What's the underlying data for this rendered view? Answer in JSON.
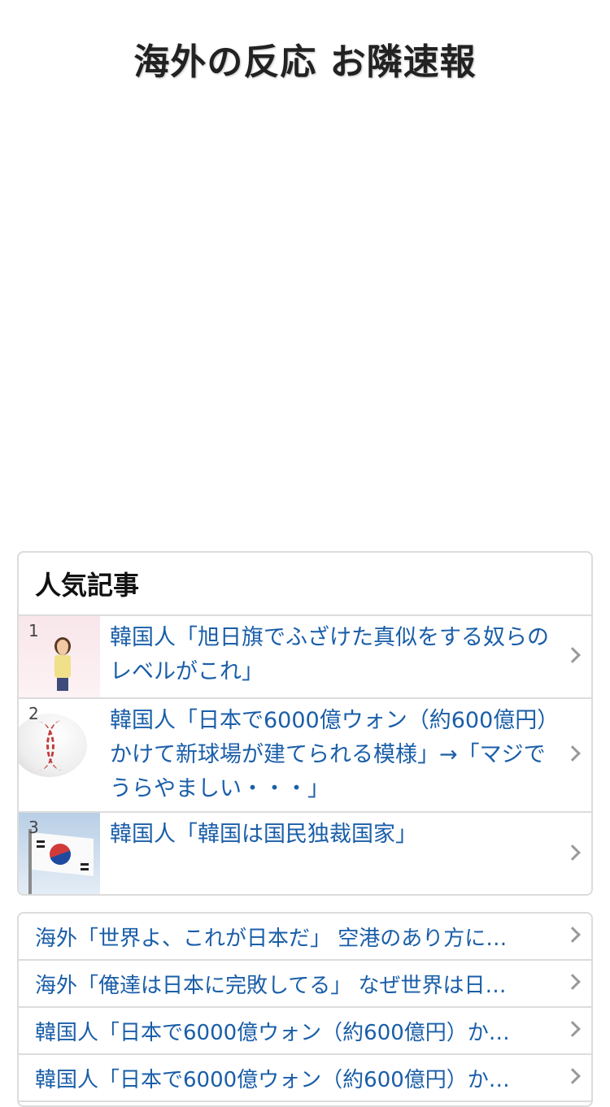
{
  "header": {
    "site_title": "海外の反応 お隣速報"
  },
  "popular": {
    "heading": "人気記事",
    "items": [
      {
        "rank": "1",
        "title": "韓国人「旭日旗でふざけた真似をする奴らのレベルがこれ」",
        "thumb_icon": "person-figure-icon"
      },
      {
        "rank": "2",
        "title": "韓国人「日本で6000億ウォン（約600億円）かけて新球場が建てられる模様」→「マジでうらやましい・・・」",
        "thumb_icon": "baseball-icon"
      },
      {
        "rank": "3",
        "title": "韓国人「韓国は国民独裁国家」",
        "thumb_icon": "korean-flag-icon"
      }
    ]
  },
  "recent": {
    "items": [
      {
        "title": "海外「世界よ、これが日本だ」 空港のあり方に…"
      },
      {
        "title": "海外「俺達は日本に完敗してる」 なぜ世界は日…"
      },
      {
        "title": "韓国人「日本で6000億ウォン（約600億円）か…"
      },
      {
        "title": "韓国人「日本で6000億ウォン（約600億円）か…"
      }
    ]
  },
  "colors": {
    "link": "#1a5ea8",
    "border": "#dcdcdc",
    "chevron": "#999999"
  }
}
